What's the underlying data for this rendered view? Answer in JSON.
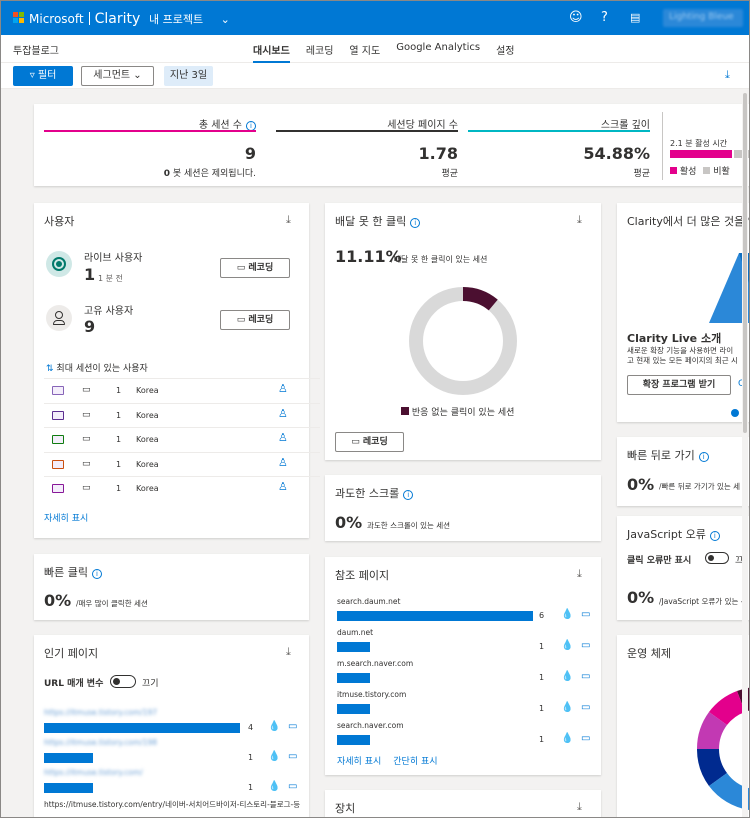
{
  "topbar": {
    "brand": "Microsoft",
    "product": "Clarity",
    "project": "내 프로젝트",
    "user": "Lighting Bleue"
  },
  "subbar": {
    "site": "투잡블로그",
    "tabs": [
      "대시보드",
      "레코딩",
      "열 지도",
      "Google Analytics",
      "설정"
    ]
  },
  "filters": {
    "filter_label": "필터",
    "segment_label": "세그먼트",
    "date_label": "지난 3일"
  },
  "metrics": {
    "sessions": {
      "label": "총 세션 수",
      "value": "9",
      "sub_bold": "0",
      "sub": "봇 세션은 제외됩니다."
    },
    "pages": {
      "label": "세션당 페이지 수",
      "value": "1.78",
      "sub": "평균"
    },
    "scroll": {
      "label": "스크롤 깊이",
      "value": "54.88%",
      "sub": "평균"
    },
    "active": {
      "label": "2.1 분 활성 시간",
      "legend_active": "활성",
      "legend_inactive": "비활"
    }
  },
  "users": {
    "title": "사용자",
    "live_label": "라이브 사용자",
    "live_count": "1",
    "live_time": "1 분 전",
    "unique_label": "고유 사용자",
    "unique_count": "9",
    "rec_label": "레코딩",
    "max_sessions_label": "최대 세션이 있는 사용자",
    "rows": [
      {
        "count": "1",
        "country": "Korea",
        "color": "#8764b8"
      },
      {
        "count": "1",
        "country": "Korea",
        "color": "#5c2e91"
      },
      {
        "count": "1",
        "country": "Korea",
        "color": "#107c10"
      },
      {
        "count": "1",
        "country": "Korea",
        "color": "#ca5010"
      },
      {
        "count": "1",
        "country": "Korea",
        "color": "#881798"
      }
    ],
    "more": "자세히 표시"
  },
  "dead_clicks": {
    "title": "배달 못 한 클릭",
    "value": "11.11%",
    "desc": "/배달 못 한 클릭이 있는 세션",
    "legend": "반응 없는 클릭이 있는 세션",
    "rec_label": "레코딩",
    "fraction": 0.1111
  },
  "clarity_promo": {
    "title": "Clarity에서 더 많은 것을 얻",
    "heading": "Clarity Live 소개",
    "line1": "새로운 확장 기능을 사용하면 라이",
    "line2": "고 현재 있는 모든 페이지의 최근 시",
    "button": "확장 프로그램 받기",
    "more": "C"
  },
  "quick_back": {
    "title": "빠른 뒤로 가기",
    "value": "0%",
    "desc": "/빠른 뒤로 가기가 있는 세"
  },
  "excess_scroll": {
    "title": "과도한 스크롤",
    "value": "0%",
    "desc": "과도한 스크롤이 있는 세션"
  },
  "js_errors": {
    "title": "JavaScript 오류",
    "toggle_label": "클릭 오류만 표시",
    "toggle_state": "끄",
    "value": "0%",
    "desc": "/JavaScript 오류가 있는 -"
  },
  "rage_clicks": {
    "title": "빠른 클릭",
    "value": "0%",
    "desc": "/매우 많이 클릭한 세션"
  },
  "referrers": {
    "title": "참조 페이지",
    "rows": [
      {
        "name": "search.daum.net",
        "count": "6",
        "fraction": 1.0
      },
      {
        "name": "daum.net",
        "count": "1",
        "fraction": 0.167
      },
      {
        "name": "m.search.naver.com",
        "count": "1",
        "fraction": 0.167
      },
      {
        "name": "itmuse.tistory.com",
        "count": "1",
        "fraction": 0.167
      },
      {
        "name": "search.naver.com",
        "count": "1",
        "fraction": 0.167
      }
    ],
    "more": "자세히 표시",
    "less": "간단히 표시"
  },
  "popular_pages": {
    "title": "인기 페이지",
    "url_param_label": "URL 매개 변수",
    "toggle_state": "끄기",
    "rows": [
      {
        "url": "https://itmuse.tistory.com/197",
        "count": "4",
        "fraction": 1.0
      },
      {
        "url": "https://itmuse.tistory.com/198",
        "count": "1",
        "fraction": 0.25
      },
      {
        "url": "https://itmuse.tistory.com/",
        "count": "1",
        "fraction": 0.25
      }
    ],
    "last_url": "https://itmuse.tistory.com/entry/네이버-서치어드바이저-티스토리-블로그-등"
  },
  "os": {
    "title": "운영 체제"
  },
  "devices": {
    "title": "장치"
  }
}
